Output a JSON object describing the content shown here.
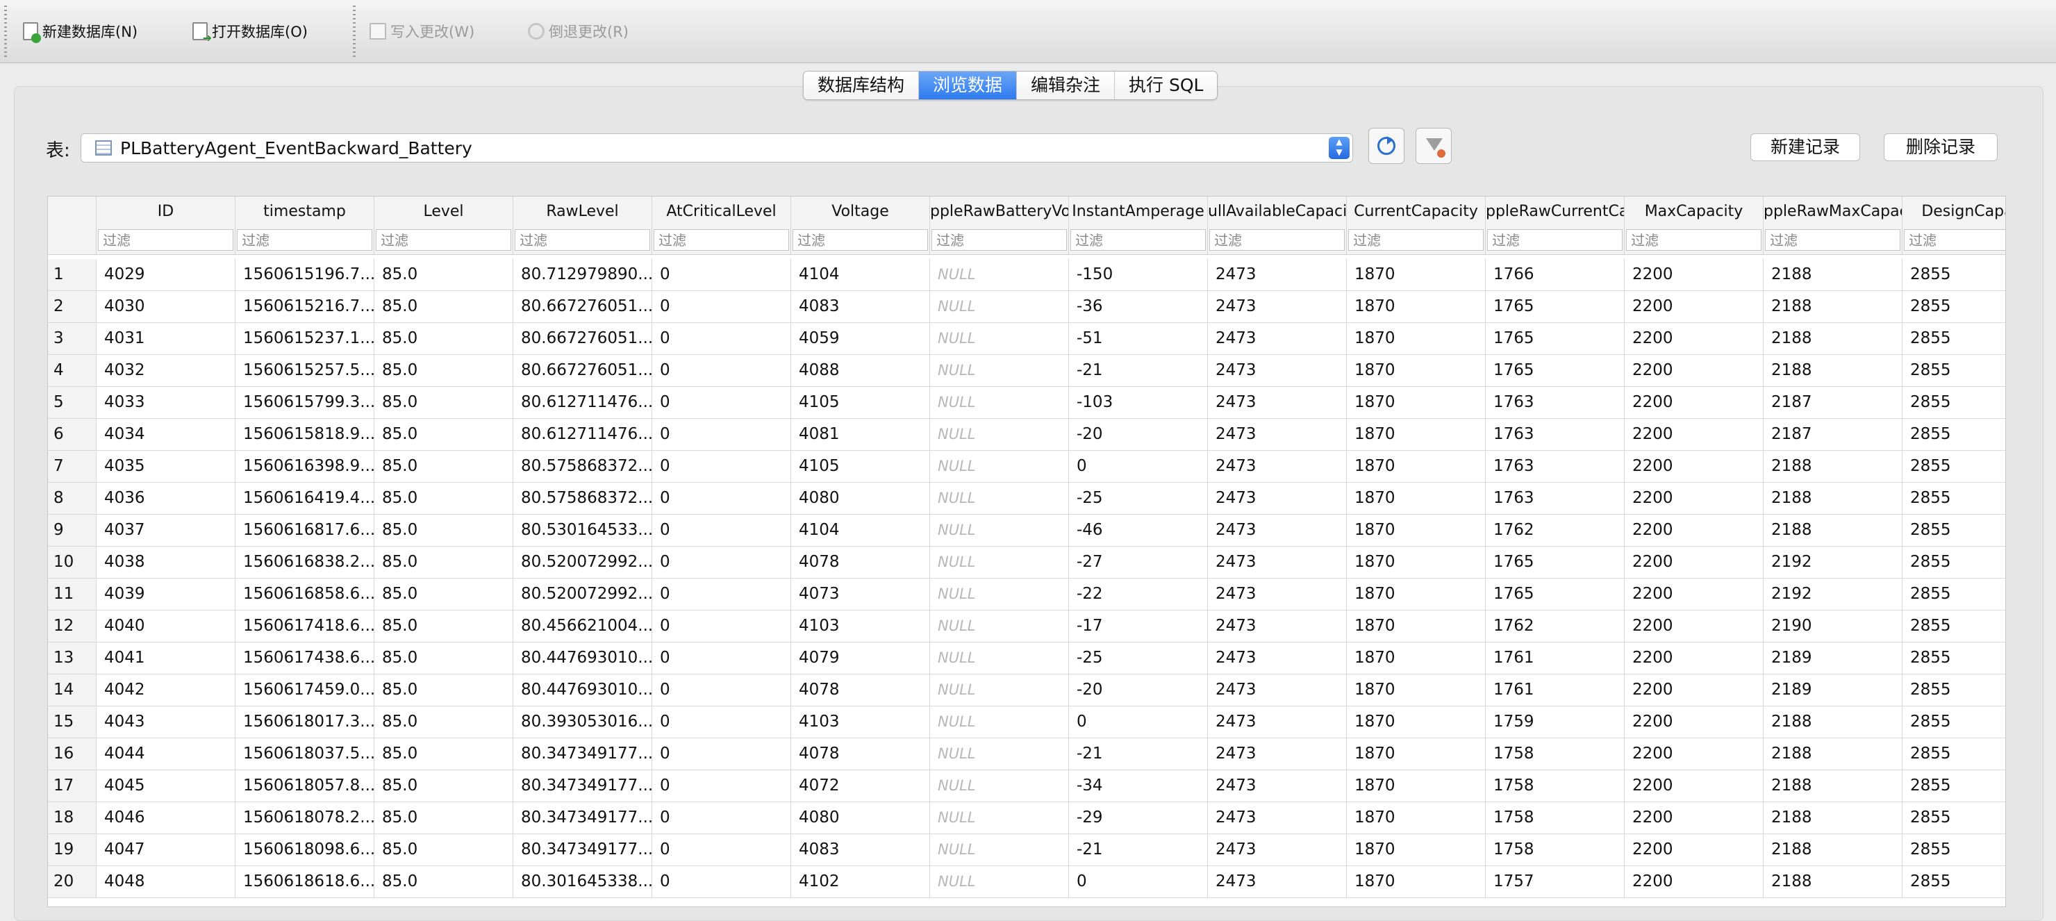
{
  "toolbar": {
    "new_db": "新建数据库(N)",
    "open_db": "打开数据库(O)",
    "write_changes": "写入更改(W)",
    "revert_changes": "倒退更改(R)"
  },
  "tabs": [
    {
      "label": "数据库结构",
      "active": false
    },
    {
      "label": "浏览数据",
      "active": true
    },
    {
      "label": "编辑杂注",
      "active": false
    },
    {
      "label": "执行 SQL",
      "active": false
    }
  ],
  "table_selector": {
    "label": "表:",
    "value": "PLBatteryAgent_EventBackward_Battery"
  },
  "buttons": {
    "new_record": "新建记录",
    "delete_record": "删除记录"
  },
  "grid": {
    "columns": [
      "ID",
      "timestamp",
      "Level",
      "RawLevel",
      "AtCriticalLevel",
      "Voltage",
      "ppleRawBatteryVolta",
      "InstantAmperage",
      "ullAvailableCapacity",
      "CurrentCapacity",
      "ppleRawCurrentCapac",
      "MaxCapacity",
      "ppleRawMaxCapacit",
      "DesignCapac"
    ],
    "filter_placeholder": "过滤",
    "rows": [
      [
        "1",
        "4029",
        "1560615196.7...",
        "85.0",
        "80.712979890...",
        "0",
        "4104",
        "NULL",
        "-150",
        "2473",
        "1870",
        "1766",
        "2200",
        "2188",
        "2855"
      ],
      [
        "2",
        "4030",
        "1560615216.7...",
        "85.0",
        "80.667276051...",
        "0",
        "4083",
        "NULL",
        "-36",
        "2473",
        "1870",
        "1765",
        "2200",
        "2188",
        "2855"
      ],
      [
        "3",
        "4031",
        "1560615237.1...",
        "85.0",
        "80.667276051...",
        "0",
        "4059",
        "NULL",
        "-51",
        "2473",
        "1870",
        "1765",
        "2200",
        "2188",
        "2855"
      ],
      [
        "4",
        "4032",
        "1560615257.5...",
        "85.0",
        "80.667276051...",
        "0",
        "4088",
        "NULL",
        "-21",
        "2473",
        "1870",
        "1765",
        "2200",
        "2188",
        "2855"
      ],
      [
        "5",
        "4033",
        "1560615799.3...",
        "85.0",
        "80.612711476...",
        "0",
        "4105",
        "NULL",
        "-103",
        "2473",
        "1870",
        "1763",
        "2200",
        "2187",
        "2855"
      ],
      [
        "6",
        "4034",
        "1560615818.9...",
        "85.0",
        "80.612711476...",
        "0",
        "4081",
        "NULL",
        "-20",
        "2473",
        "1870",
        "1763",
        "2200",
        "2187",
        "2855"
      ],
      [
        "7",
        "4035",
        "1560616398.9...",
        "85.0",
        "80.575868372...",
        "0",
        "4105",
        "NULL",
        "0",
        "2473",
        "1870",
        "1763",
        "2200",
        "2188",
        "2855"
      ],
      [
        "8",
        "4036",
        "1560616419.4...",
        "85.0",
        "80.575868372...",
        "0",
        "4080",
        "NULL",
        "-25",
        "2473",
        "1870",
        "1763",
        "2200",
        "2188",
        "2855"
      ],
      [
        "9",
        "4037",
        "1560616817.6...",
        "85.0",
        "80.530164533...",
        "0",
        "4104",
        "NULL",
        "-46",
        "2473",
        "1870",
        "1762",
        "2200",
        "2188",
        "2855"
      ],
      [
        "10",
        "4038",
        "1560616838.2...",
        "85.0",
        "80.520072992...",
        "0",
        "4078",
        "NULL",
        "-27",
        "2473",
        "1870",
        "1765",
        "2200",
        "2192",
        "2855"
      ],
      [
        "11",
        "4039",
        "1560616858.6...",
        "85.0",
        "80.520072992...",
        "0",
        "4073",
        "NULL",
        "-22",
        "2473",
        "1870",
        "1765",
        "2200",
        "2192",
        "2855"
      ],
      [
        "12",
        "4040",
        "1560617418.6...",
        "85.0",
        "80.456621004...",
        "0",
        "4103",
        "NULL",
        "-17",
        "2473",
        "1870",
        "1762",
        "2200",
        "2190",
        "2855"
      ],
      [
        "13",
        "4041",
        "1560617438.6...",
        "85.0",
        "80.447693010...",
        "0",
        "4079",
        "NULL",
        "-25",
        "2473",
        "1870",
        "1761",
        "2200",
        "2189",
        "2855"
      ],
      [
        "14",
        "4042",
        "1560617459.0...",
        "85.0",
        "80.447693010...",
        "0",
        "4078",
        "NULL",
        "-20",
        "2473",
        "1870",
        "1761",
        "2200",
        "2189",
        "2855"
      ],
      [
        "15",
        "4043",
        "1560618017.3...",
        "85.0",
        "80.393053016...",
        "0",
        "4103",
        "NULL",
        "0",
        "2473",
        "1870",
        "1759",
        "2200",
        "2188",
        "2855"
      ],
      [
        "16",
        "4044",
        "1560618037.5...",
        "85.0",
        "80.347349177...",
        "0",
        "4078",
        "NULL",
        "-21",
        "2473",
        "1870",
        "1758",
        "2200",
        "2188",
        "2855"
      ],
      [
        "17",
        "4045",
        "1560618057.8...",
        "85.0",
        "80.347349177...",
        "0",
        "4072",
        "NULL",
        "-34",
        "2473",
        "1870",
        "1758",
        "2200",
        "2188",
        "2855"
      ],
      [
        "18",
        "4046",
        "1560618078.2...",
        "85.0",
        "80.347349177...",
        "0",
        "4080",
        "NULL",
        "-29",
        "2473",
        "1870",
        "1758",
        "2200",
        "2188",
        "2855"
      ],
      [
        "19",
        "4047",
        "1560618098.6...",
        "85.0",
        "80.347349177...",
        "0",
        "4083",
        "NULL",
        "-21",
        "2473",
        "1870",
        "1758",
        "2200",
        "2188",
        "2855"
      ],
      [
        "20",
        "4048",
        "1560618618.6...",
        "85.0",
        "80.301645338...",
        "0",
        "4102",
        "NULL",
        "0",
        "2473",
        "1870",
        "1757",
        "2200",
        "2188",
        "2855"
      ]
    ]
  }
}
